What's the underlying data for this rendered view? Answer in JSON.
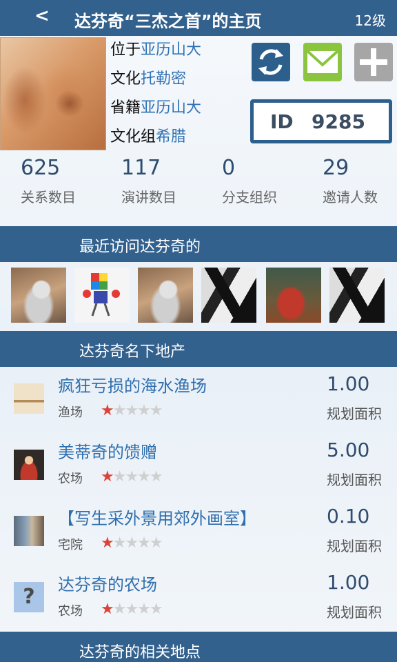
{
  "header": {
    "back_label": "<",
    "title": "达芬奇“三杰之首”的主页",
    "level": "12级"
  },
  "profile": {
    "fields": [
      {
        "key": "位于",
        "value": "亚历山大"
      },
      {
        "key": "文化",
        "value": "托勒密"
      },
      {
        "key": "省籍",
        "value": "亚历山大"
      },
      {
        "key": "文化组",
        "value": "希腊"
      }
    ],
    "id_label": "ID",
    "id_value": "9285"
  },
  "actions": {
    "refresh_icon": "refresh-icon",
    "mail_icon": "mail-icon",
    "add_icon": "plus-icon",
    "colors": {
      "refresh": "#2d5f8d",
      "mail": "#8bc53f",
      "add": "#a6a6a6"
    }
  },
  "stats": [
    {
      "value": "625",
      "label": "关系数目"
    },
    {
      "value": "117",
      "label": "演讲数目"
    },
    {
      "value": "0",
      "label": "分支组织"
    },
    {
      "value": "29",
      "label": "邀请人数"
    }
  ],
  "sections": {
    "recent_visitors": "最近访问达芬奇的",
    "estates": "达芬奇名下地产",
    "places": "达芬奇的相关地点"
  },
  "estates": [
    {
      "name": "疯狂亏损的海水渔场",
      "type": "渔场",
      "rating": 1,
      "max_rating": 5,
      "value": "1.00",
      "unit": "规划面积"
    },
    {
      "name": "美蒂奇的馈赠",
      "type": "农场",
      "rating": 1,
      "max_rating": 5,
      "value": "5.00",
      "unit": "规划面积"
    },
    {
      "name": "【写生采外景用郊外画室】",
      "type": "宅院",
      "rating": 1,
      "max_rating": 5,
      "value": "0.10",
      "unit": "规划面积"
    },
    {
      "name": "达芬奇的农场",
      "type": "农场",
      "rating": 1,
      "max_rating": 5,
      "value": "1.00",
      "unit": "规划面积",
      "thumb_glyph": "?"
    }
  ],
  "theme": {
    "header_bg": "#33618d",
    "link_color": "#2f72b5",
    "star_on": "#d9443a",
    "star_off": "#cfcfcf"
  }
}
